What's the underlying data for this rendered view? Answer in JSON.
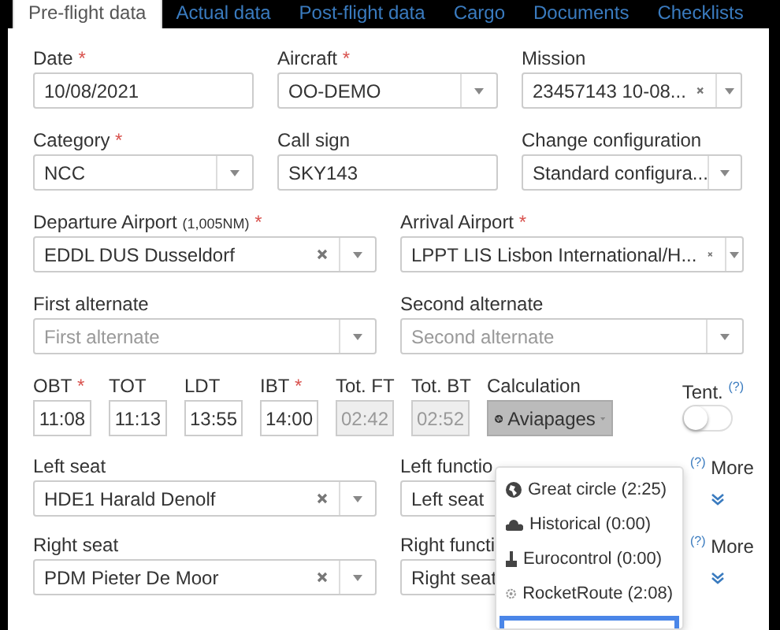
{
  "tabs": [
    {
      "label": "Pre-flight data",
      "selected": true
    },
    {
      "label": "Actual data",
      "selected": false
    },
    {
      "label": "Post-flight data",
      "selected": false
    },
    {
      "label": "Cargo",
      "selected": false
    },
    {
      "label": "Documents",
      "selected": false
    },
    {
      "label": "Checklists",
      "selected": false
    }
  ],
  "rows": [
    {
      "fields": [
        {
          "label": "Date",
          "required_mark": "*",
          "kind": "text",
          "value": "10/08/2021"
        },
        {
          "label": "Aircraft",
          "required_mark": "*",
          "kind": "select",
          "value": "OO-DEMO",
          "clearable": false
        },
        {
          "label": "Mission",
          "kind": "select",
          "value": "23457143 10-08...",
          "clearable": true
        }
      ]
    },
    {
      "fields": [
        {
          "label": "Category",
          "required_mark": "*",
          "kind": "select",
          "value": "NCC",
          "clearable": false
        },
        {
          "label": "Call sign",
          "kind": "text",
          "value": "SKY143"
        },
        {
          "label": "Change configuration",
          "kind": "select",
          "value": "Standard configura...",
          "clearable": false
        }
      ]
    },
    {
      "fields": [
        {
          "label": "Departure Airport",
          "label_note": "(1,005NM)",
          "required_mark": "*",
          "kind": "select",
          "value": "EDDL DUS Dusseldorf",
          "clearable": true
        },
        {
          "label": "Arrival Airport",
          "required_mark": "*",
          "kind": "select",
          "value": "LPPT LIS Lisbon International/H...",
          "clearable": true
        }
      ]
    },
    {
      "fields": [
        {
          "label": "First alternate",
          "kind": "select",
          "placeholder": "First alternate",
          "clearable": false
        },
        {
          "label": "Second alternate",
          "kind": "select",
          "placeholder": "Second alternate",
          "clearable": false
        }
      ]
    }
  ],
  "times": [
    {
      "label": "OBT",
      "required_mark": "*",
      "value": "11:08",
      "disabled": false
    },
    {
      "label": "TOT",
      "value": "11:13",
      "disabled": false
    },
    {
      "label": "LDT",
      "value": "13:55",
      "disabled": false
    },
    {
      "label": "IBT",
      "required_mark": "*",
      "value": "14:00",
      "disabled": false
    },
    {
      "label": "Tot. FT",
      "value": "02:42",
      "disabled": true
    },
    {
      "label": "Tot. BT",
      "value": "02:52",
      "disabled": true
    }
  ],
  "calculation": {
    "label": "Calculation",
    "button": "Aviapages",
    "expanded": true
  },
  "tentative": {
    "label": "Tent.",
    "help": "(?)",
    "on": false
  },
  "seats": [
    {
      "label": "Left seat",
      "value": "HDE1 Harald Denolf",
      "function_label": "Left functio",
      "function_value": "Left seat",
      "help": "(?)",
      "more": "More"
    },
    {
      "label": "Right seat",
      "value": "PDM Pieter De Moor",
      "function_label": "Right functi",
      "function_value": "Right seat",
      "help": "(?)",
      "more": "More"
    }
  ],
  "menu": {
    "items": [
      {
        "label": "Great circle (2:25)",
        "kind": "globe",
        "selected": false
      },
      {
        "label": "Historical  (0:00)",
        "kind": "cloud",
        "selected": false
      },
      {
        "label": "Eurocontrol  (0:00)",
        "kind": "pin",
        "selected": false
      },
      {
        "label": "RocketRoute  (2:08)",
        "kind": "gear",
        "selected": false
      }
    ],
    "partial_highlighted_item": true
  }
}
